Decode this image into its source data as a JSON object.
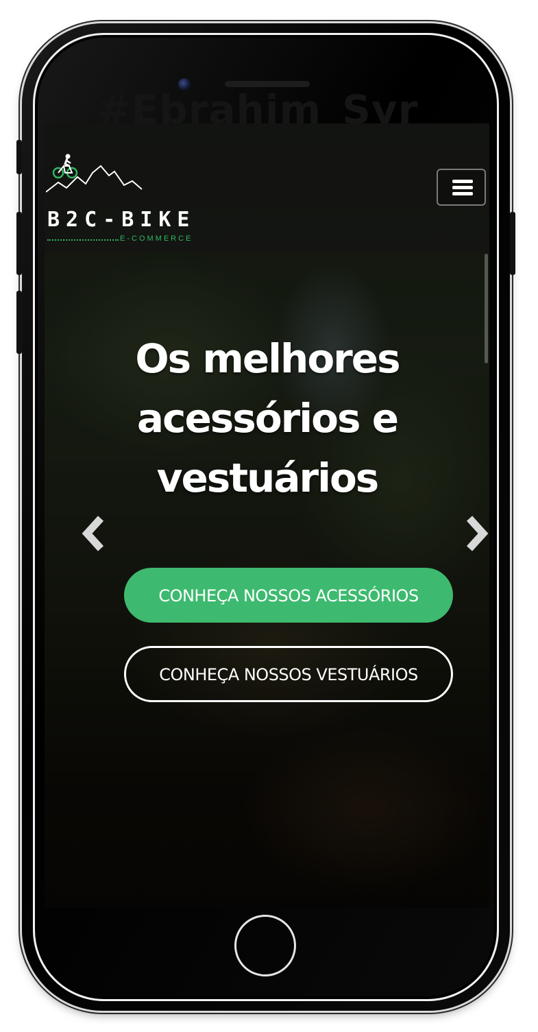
{
  "device": {
    "watermark": "#Ebrahim_Syr"
  },
  "navbar": {
    "logo_main": "B2C-BIKE",
    "logo_sub": "E-COMMERCE",
    "menu_icon": "hamburger-menu-icon"
  },
  "hero": {
    "title": "Os melhores acessórios e vestuários",
    "prev_icon": "chevron-left-icon",
    "next_icon": "chevron-right-icon",
    "primary_button": "CONHEÇA NOSSOS ACESSÓRIOS",
    "secondary_button": "CONHEÇA NOSSOS VESTUÁRIOS"
  },
  "colors": {
    "accent_green": "#3dba6f",
    "logo_green": "#2fb862",
    "text": "#ffffff"
  }
}
